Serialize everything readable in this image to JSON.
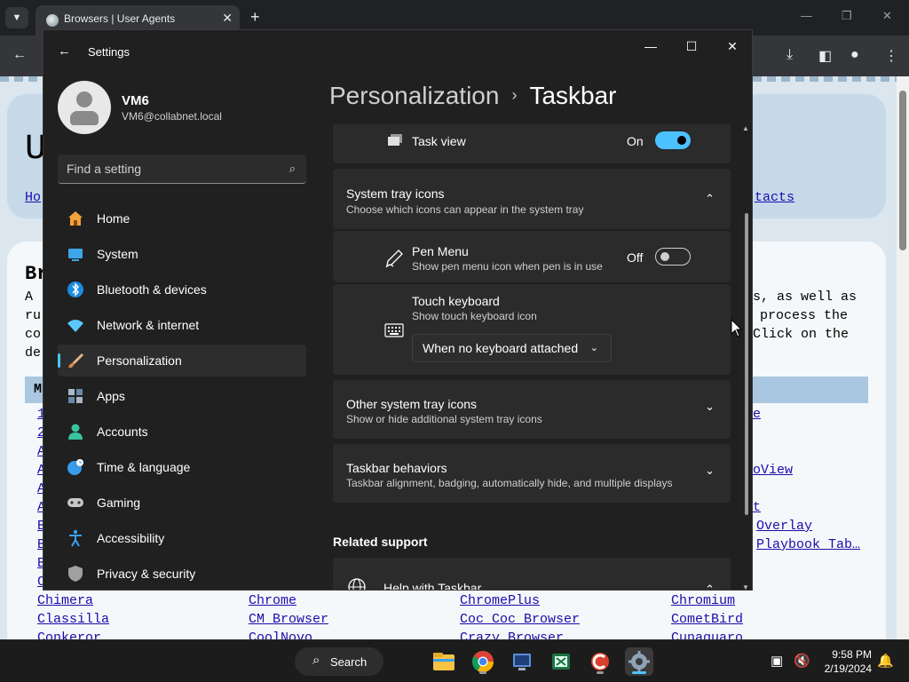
{
  "browser": {
    "tab_title": "Browsers | User Agents",
    "page_lines": {
      "heading_partial": "U",
      "nav_left": "Ho",
      "nav_right": "tacts",
      "bold_partial": "Br",
      "right_text": [
        "s, as well as",
        "process the",
        "Click on the"
      ],
      "left_chars": [
        "A",
        "ru",
        "co",
        "de"
      ],
      "list_prefix": [
        "1",
        "2",
        "A",
        "A",
        "A",
        "A",
        "B",
        "B",
        "B",
        "C"
      ],
      "bar_letter": "M",
      "right_links": [
        "e",
        "oView",
        "t",
        "Overlay",
        "Playbook Tab…"
      ],
      "row1": [
        "Chimera",
        "Chrome",
        "ChromePlus",
        "Chromium"
      ],
      "row2": [
        "Classilla",
        "CM Browser",
        "Coc Coc Browser",
        "CometBird"
      ],
      "row3": [
        "Conkeror",
        "CoolNovo",
        "Crazy Browser",
        "Cunaguaro"
      ]
    }
  },
  "settings": {
    "app_title": "Settings",
    "user": {
      "name": "VM6",
      "email": "VM6@collabnet.local"
    },
    "search": {
      "placeholder": "Find a setting"
    },
    "nav": [
      {
        "label": "Home",
        "icon": "home-icon",
        "color": "#f2a33a"
      },
      {
        "label": "System",
        "icon": "system-icon",
        "color": "#3ea6e8"
      },
      {
        "label": "Bluetooth & devices",
        "icon": "bluetooth-icon",
        "color": "#1a8cde"
      },
      {
        "label": "Network & internet",
        "icon": "wifi-icon",
        "color": "#5ac8fa"
      },
      {
        "label": "Personalization",
        "icon": "brush-icon",
        "color": "#e3b78a",
        "selected": true
      },
      {
        "label": "Apps",
        "icon": "apps-icon",
        "color": "#a8b8c8"
      },
      {
        "label": "Accounts",
        "icon": "accounts-icon",
        "color": "#38c3a0"
      },
      {
        "label": "Time & language",
        "icon": "globe-clock-icon",
        "color": "#3a9be8"
      },
      {
        "label": "Gaming",
        "icon": "gamepad-icon",
        "color": "#c8c8c8"
      },
      {
        "label": "Accessibility",
        "icon": "accessibility-icon",
        "color": "#3aa0f0"
      },
      {
        "label": "Privacy & security",
        "icon": "shield-icon",
        "color": "#a0a0a0"
      }
    ],
    "breadcrumb": {
      "parent": "Personalization",
      "separator": "›",
      "current": "Taskbar"
    },
    "content": {
      "task_view": {
        "label": "Task view",
        "state": "On"
      },
      "system_tray": {
        "title": "System tray icons",
        "subtitle": "Choose which icons can appear in the system tray"
      },
      "pen_menu": {
        "title": "Pen Menu",
        "subtitle": "Show pen menu icon when pen is in use",
        "state": "Off"
      },
      "touch_keyboard": {
        "title": "Touch keyboard",
        "subtitle": "Show touch keyboard icon",
        "value": "When no keyboard attached"
      },
      "other_tray": {
        "title": "Other system tray icons",
        "subtitle": "Show or hide additional system tray icons"
      },
      "behaviors": {
        "title": "Taskbar behaviors",
        "subtitle": "Taskbar alignment, badging, automatically hide, and multiple displays"
      },
      "related_support": "Related support",
      "help": {
        "title": "Help with Taskbar"
      }
    }
  },
  "taskbar": {
    "search_label": "Search",
    "time": "9:58 PM",
    "date": "2/19/2024"
  }
}
